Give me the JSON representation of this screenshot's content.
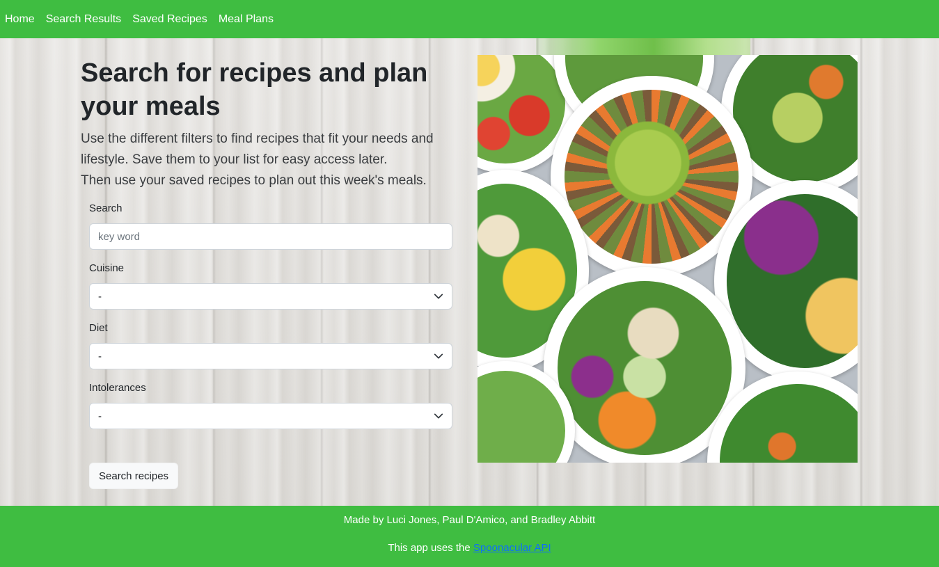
{
  "nav": {
    "items": [
      {
        "label": "Home"
      },
      {
        "label": "Search Results"
      },
      {
        "label": "Saved Recipes"
      },
      {
        "label": "Meal Plans"
      }
    ]
  },
  "hero": {
    "title": "Search for recipes and plan your meals",
    "lead_line1": "Use the different filters to find recipes that fit your needs and lifestyle. Save them to your list for easy access later.",
    "lead_line2": "Then use your saved recipes to plan out this week's meals."
  },
  "form": {
    "search_label": "Search",
    "search_placeholder": "key word",
    "search_value": "",
    "cuisine_label": "Cuisine",
    "cuisine_value": "-",
    "diet_label": "Diet",
    "diet_value": "-",
    "intolerances_label": "Intolerances",
    "intolerances_value": "-",
    "submit_label": "Search recipes"
  },
  "footer": {
    "credit": "Made by Luci Jones, Paul D'Amico, and Bradley Abbitt",
    "api_prefix": "This app uses the ",
    "api_link": "Spoonacular API"
  },
  "colors": {
    "brand_green": "#3fbd41",
    "link_blue": "#0d6efd"
  },
  "icons": {
    "select_arrow": "chevron-down-icon"
  }
}
